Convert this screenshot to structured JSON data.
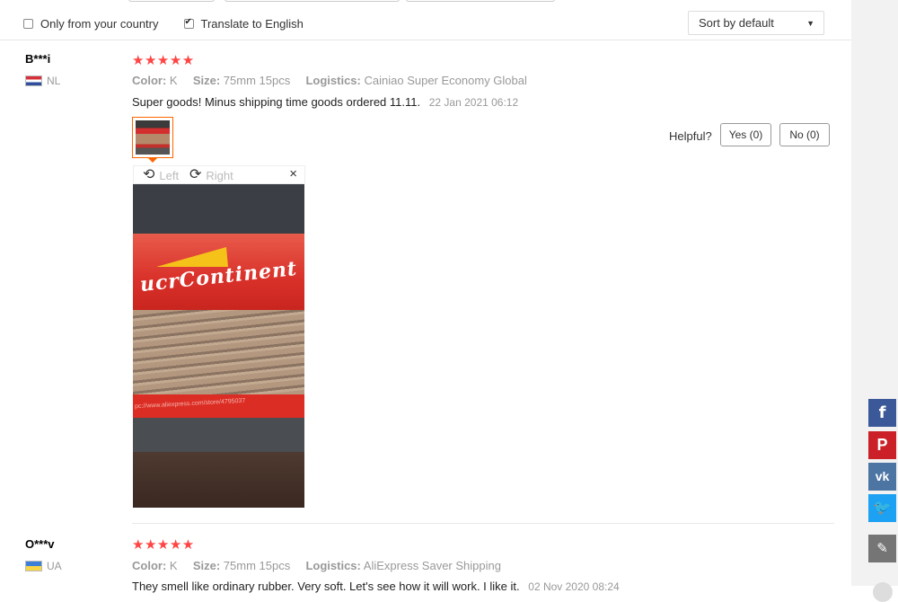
{
  "filters": {
    "only_country": {
      "label": "Only from your country",
      "checked": false
    },
    "translate": {
      "label": "Translate to English",
      "checked": true
    },
    "sort": {
      "value": "Sort by default"
    }
  },
  "reviews": [
    {
      "user": "B***i",
      "country": "NL",
      "stars": "★★★★★",
      "attributes": [
        {
          "key": "Color:",
          "value": "K"
        },
        {
          "key": "Size:",
          "value": "75mm 15pcs"
        },
        {
          "key": "Logistics:",
          "value": "Cainiao Super Economy Global"
        }
      ],
      "text": "Super goods! Minus shipping time goods ordered 11.11.",
      "date": "22 Jan 2021 06:12",
      "helpful_label": "Helpful?",
      "yes_label": "Yes (0)",
      "no_label": "No (0)",
      "viewer": {
        "left_label": "Left",
        "right_label": "Right",
        "close": "×",
        "image_text": "ucrContinent",
        "image_url_text": "pc://www.aliexpress.com/store/4795037"
      }
    },
    {
      "user": "O***v",
      "country": "UA",
      "stars": "★★★★★",
      "attributes": [
        {
          "key": "Color:",
          "value": "K"
        },
        {
          "key": "Size:",
          "value": "75mm 15pcs"
        },
        {
          "key": "Logistics:",
          "value": "AliExpress Saver Shipping"
        }
      ],
      "text": "They smell like ordinary rubber. Very soft. Let's see how it will work. I like it.",
      "date": "02 Nov 2020 08:24"
    }
  ],
  "social": {
    "facebook": "f",
    "pinterest": "P",
    "vk": "vk",
    "twitter": "🐦",
    "edit": "✎"
  },
  "icons": {
    "rotate_left": "⟲",
    "rotate_right": "⟳",
    "chevron": "⌄"
  },
  "colors": {
    "star": "#ff4444",
    "thumb_border": "#ff6600",
    "facebook": "#3b5998",
    "pinterest": "#cb2027",
    "vk": "#4c75a3",
    "twitter": "#1da1f2"
  }
}
